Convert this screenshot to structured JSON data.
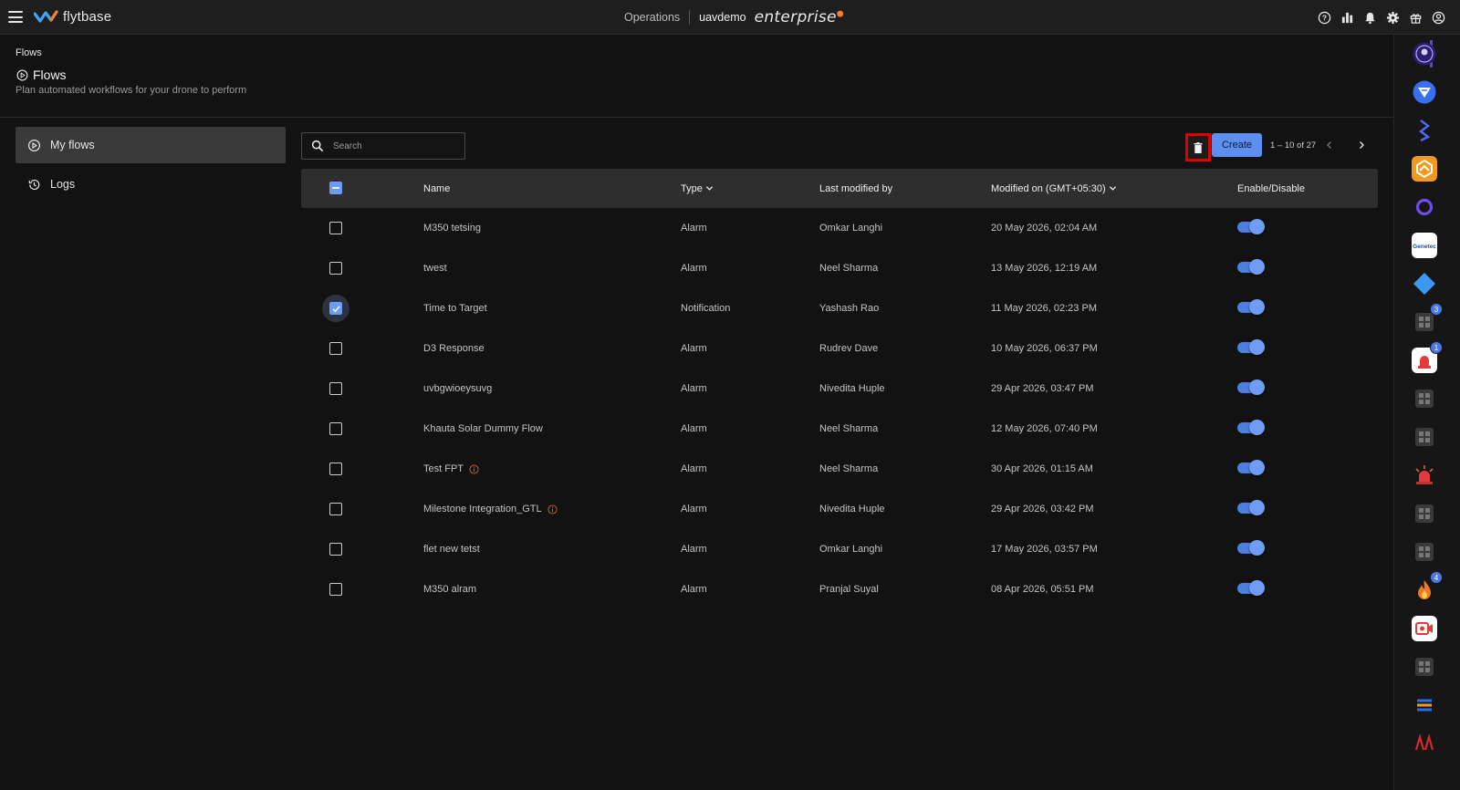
{
  "topbar": {
    "logo_text": "flytbase",
    "section": "Operations",
    "org": "uavdemo",
    "plan": "enterprise"
  },
  "header": {
    "breadcrumb": "Flows",
    "title": "Flows",
    "subtitle": "Plan automated workflows for your drone to perform"
  },
  "sidebar": {
    "items": [
      {
        "label": "My flows",
        "active": true
      },
      {
        "label": "Logs",
        "active": false
      }
    ]
  },
  "search": {
    "placeholder": "Search",
    "value": ""
  },
  "toolbar": {
    "create_label": "Create",
    "pager_text": "1 – 10 of 27"
  },
  "table": {
    "columns": {
      "name": "Name",
      "type": "Type",
      "last_modified_by": "Last modified by",
      "modified_on": "Modified on (GMT+05:30)",
      "enable": "Enable/Disable"
    },
    "rows": [
      {
        "name": "M350 tetsing",
        "type": "Alarm",
        "by": "Omkar Langhi",
        "modified": "20 May 2026, 02:04 AM",
        "checked": false,
        "info": false,
        "enabled": true
      },
      {
        "name": "twest",
        "type": "Alarm",
        "by": "Neel Sharma",
        "modified": "13 May 2026, 12:19 AM",
        "checked": false,
        "info": false,
        "enabled": true
      },
      {
        "name": "Time to Target",
        "type": "Notification",
        "by": "Yashash Rao",
        "modified": "11 May 2026, 02:23 PM",
        "checked": true,
        "info": false,
        "enabled": true
      },
      {
        "name": "D3 Response",
        "type": "Alarm",
        "by": "Rudrev Dave",
        "modified": "10 May 2026, 06:37 PM",
        "checked": false,
        "info": false,
        "enabled": true
      },
      {
        "name": "uvbgwioeysuvg",
        "type": "Alarm",
        "by": "Nivedita Huple",
        "modified": "29 Apr 2026, 03:47 PM",
        "checked": false,
        "info": false,
        "enabled": true
      },
      {
        "name": "Khauta Solar Dummy Flow",
        "type": "Alarm",
        "by": "Neel Sharma",
        "modified": "12 May 2026, 07:40 PM",
        "checked": false,
        "info": false,
        "enabled": true
      },
      {
        "name": "Test FPT",
        "type": "Alarm",
        "by": "Neel Sharma",
        "modified": "30 Apr 2026, 01:15 AM",
        "checked": false,
        "info": true,
        "enabled": true
      },
      {
        "name": "Milestone Integration_GTL",
        "type": "Alarm",
        "by": "Nivedita Huple",
        "modified": "29 Apr 2026, 03:42 PM",
        "checked": false,
        "info": true,
        "enabled": true
      },
      {
        "name": "flet new tetst",
        "type": "Alarm",
        "by": "Omkar Langhi",
        "modified": "17 May 2026, 03:57 PM",
        "checked": false,
        "info": false,
        "enabled": true
      },
      {
        "name": "M350 alram",
        "type": "Alarm",
        "by": "Pranjal Suyal",
        "modified": "08 Apr 2026, 05:51 PM",
        "checked": false,
        "info": false,
        "enabled": true
      }
    ]
  },
  "rail": {
    "badges": {
      "app8": "3",
      "app9": "1",
      "app15": "4"
    }
  },
  "colors": {
    "accent": "#5d8ff0",
    "delete_highlight": "#e00000",
    "background": "#121212"
  }
}
